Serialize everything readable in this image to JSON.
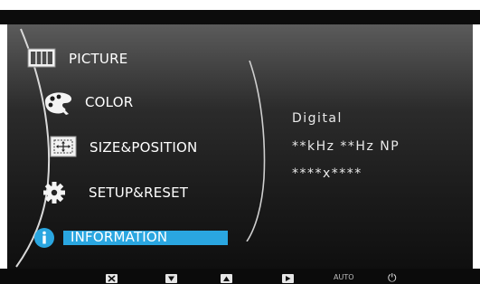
{
  "menu": {
    "items": [
      {
        "label": "PICTURE",
        "icon": "picture-icon",
        "selected": false
      },
      {
        "label": "COLOR",
        "icon": "palette-icon",
        "selected": false
      },
      {
        "label": "SIZE&POSITION",
        "icon": "size-position-icon",
        "selected": false
      },
      {
        "label": "SETUP&RESET",
        "icon": "gear-icon",
        "selected": false
      },
      {
        "label": "INFORMATION",
        "icon": "info-icon",
        "selected": true
      }
    ]
  },
  "information": {
    "signal": "Digital",
    "frequency": "**kHz **Hz NP",
    "resolution": "****x****"
  },
  "key_guide": {
    "keys": [
      "close-icon",
      "down-arrow-icon",
      "up-arrow-icon",
      "enter-icon"
    ],
    "auto_label": "AUTO",
    "power_glyph": "⏻"
  },
  "colors": {
    "selected_highlight": "#2aa6e0",
    "panel_dark": "#1b1b1b"
  }
}
